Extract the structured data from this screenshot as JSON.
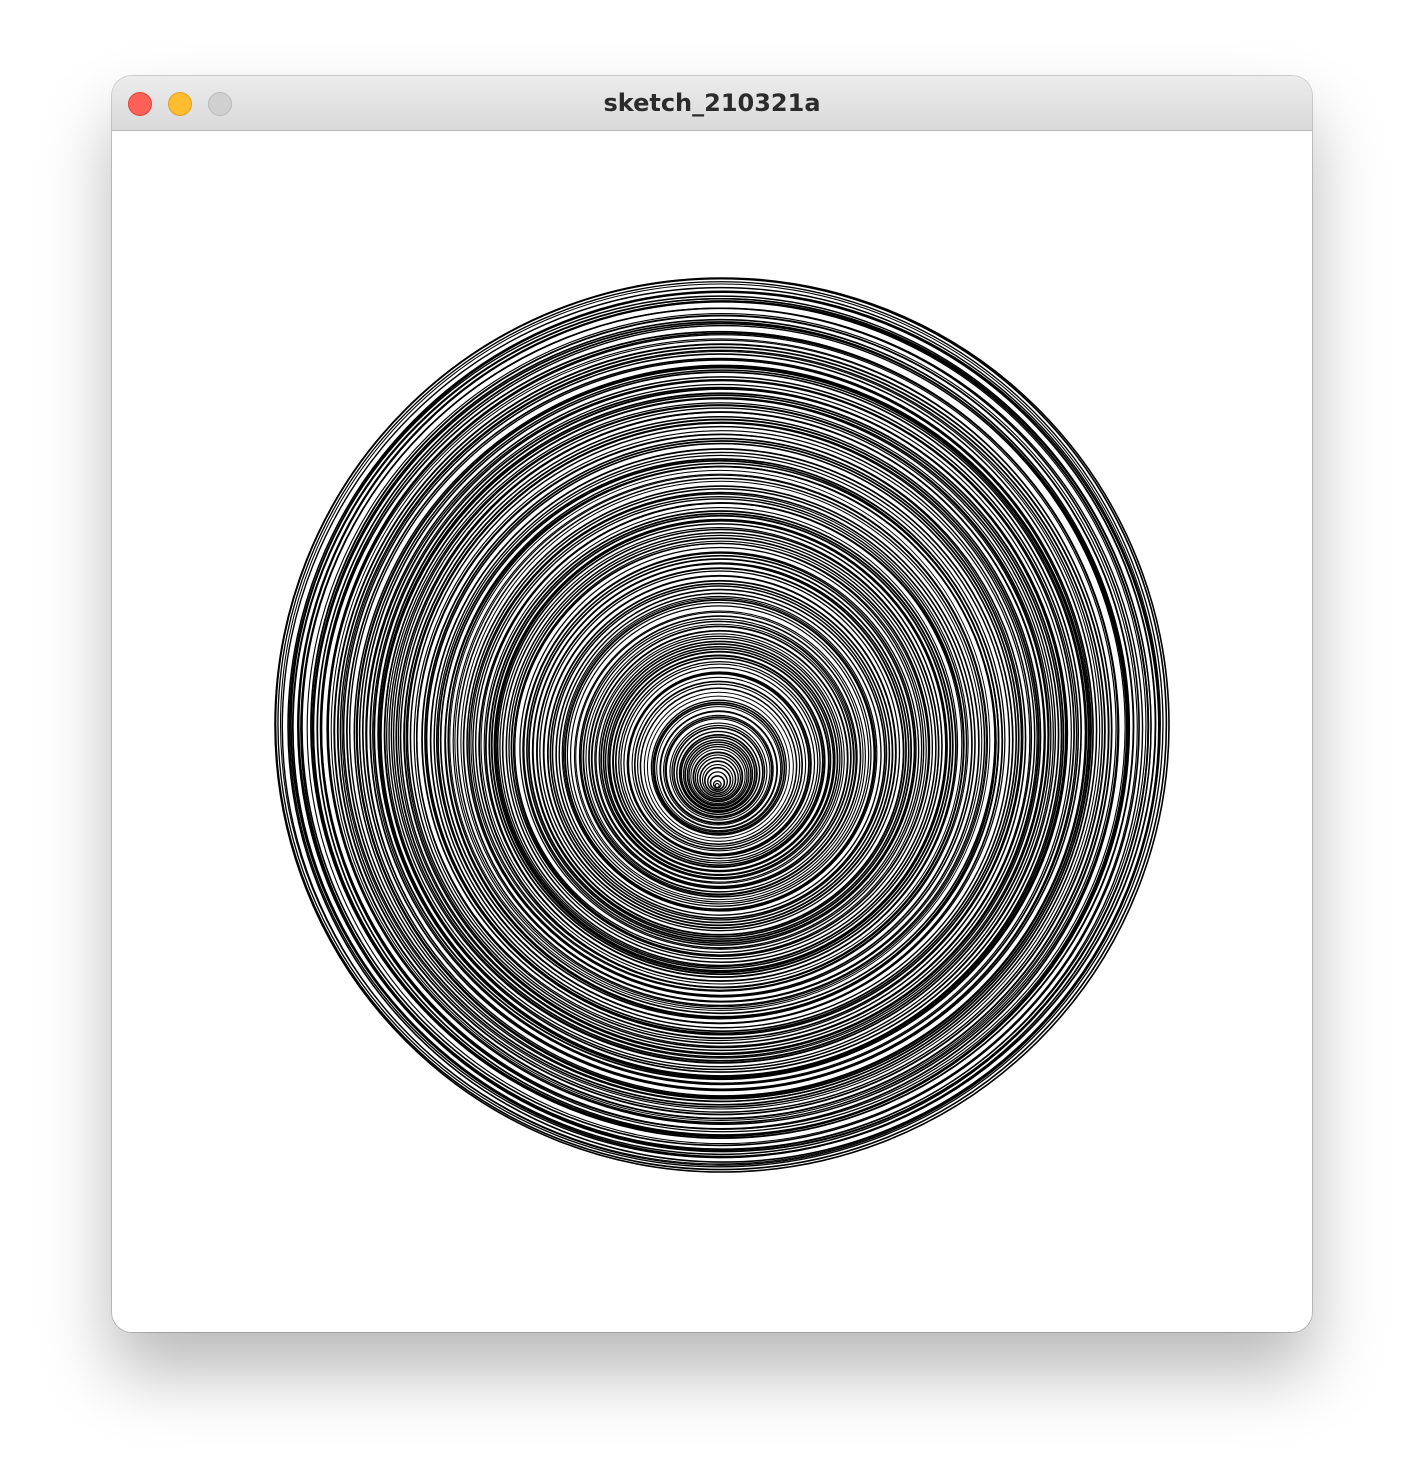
{
  "window": {
    "title": "sketch_210321a",
    "controls": {
      "close": "close-button",
      "minimize": "minimize-button",
      "zoom": "zoom-button"
    },
    "colors": {
      "close": "#fe5f57",
      "minimize": "#febc2e",
      "zoom_disabled": "#d0d0d0",
      "canvas_background": "#ffffff",
      "stroke": "#000000"
    }
  }
}
